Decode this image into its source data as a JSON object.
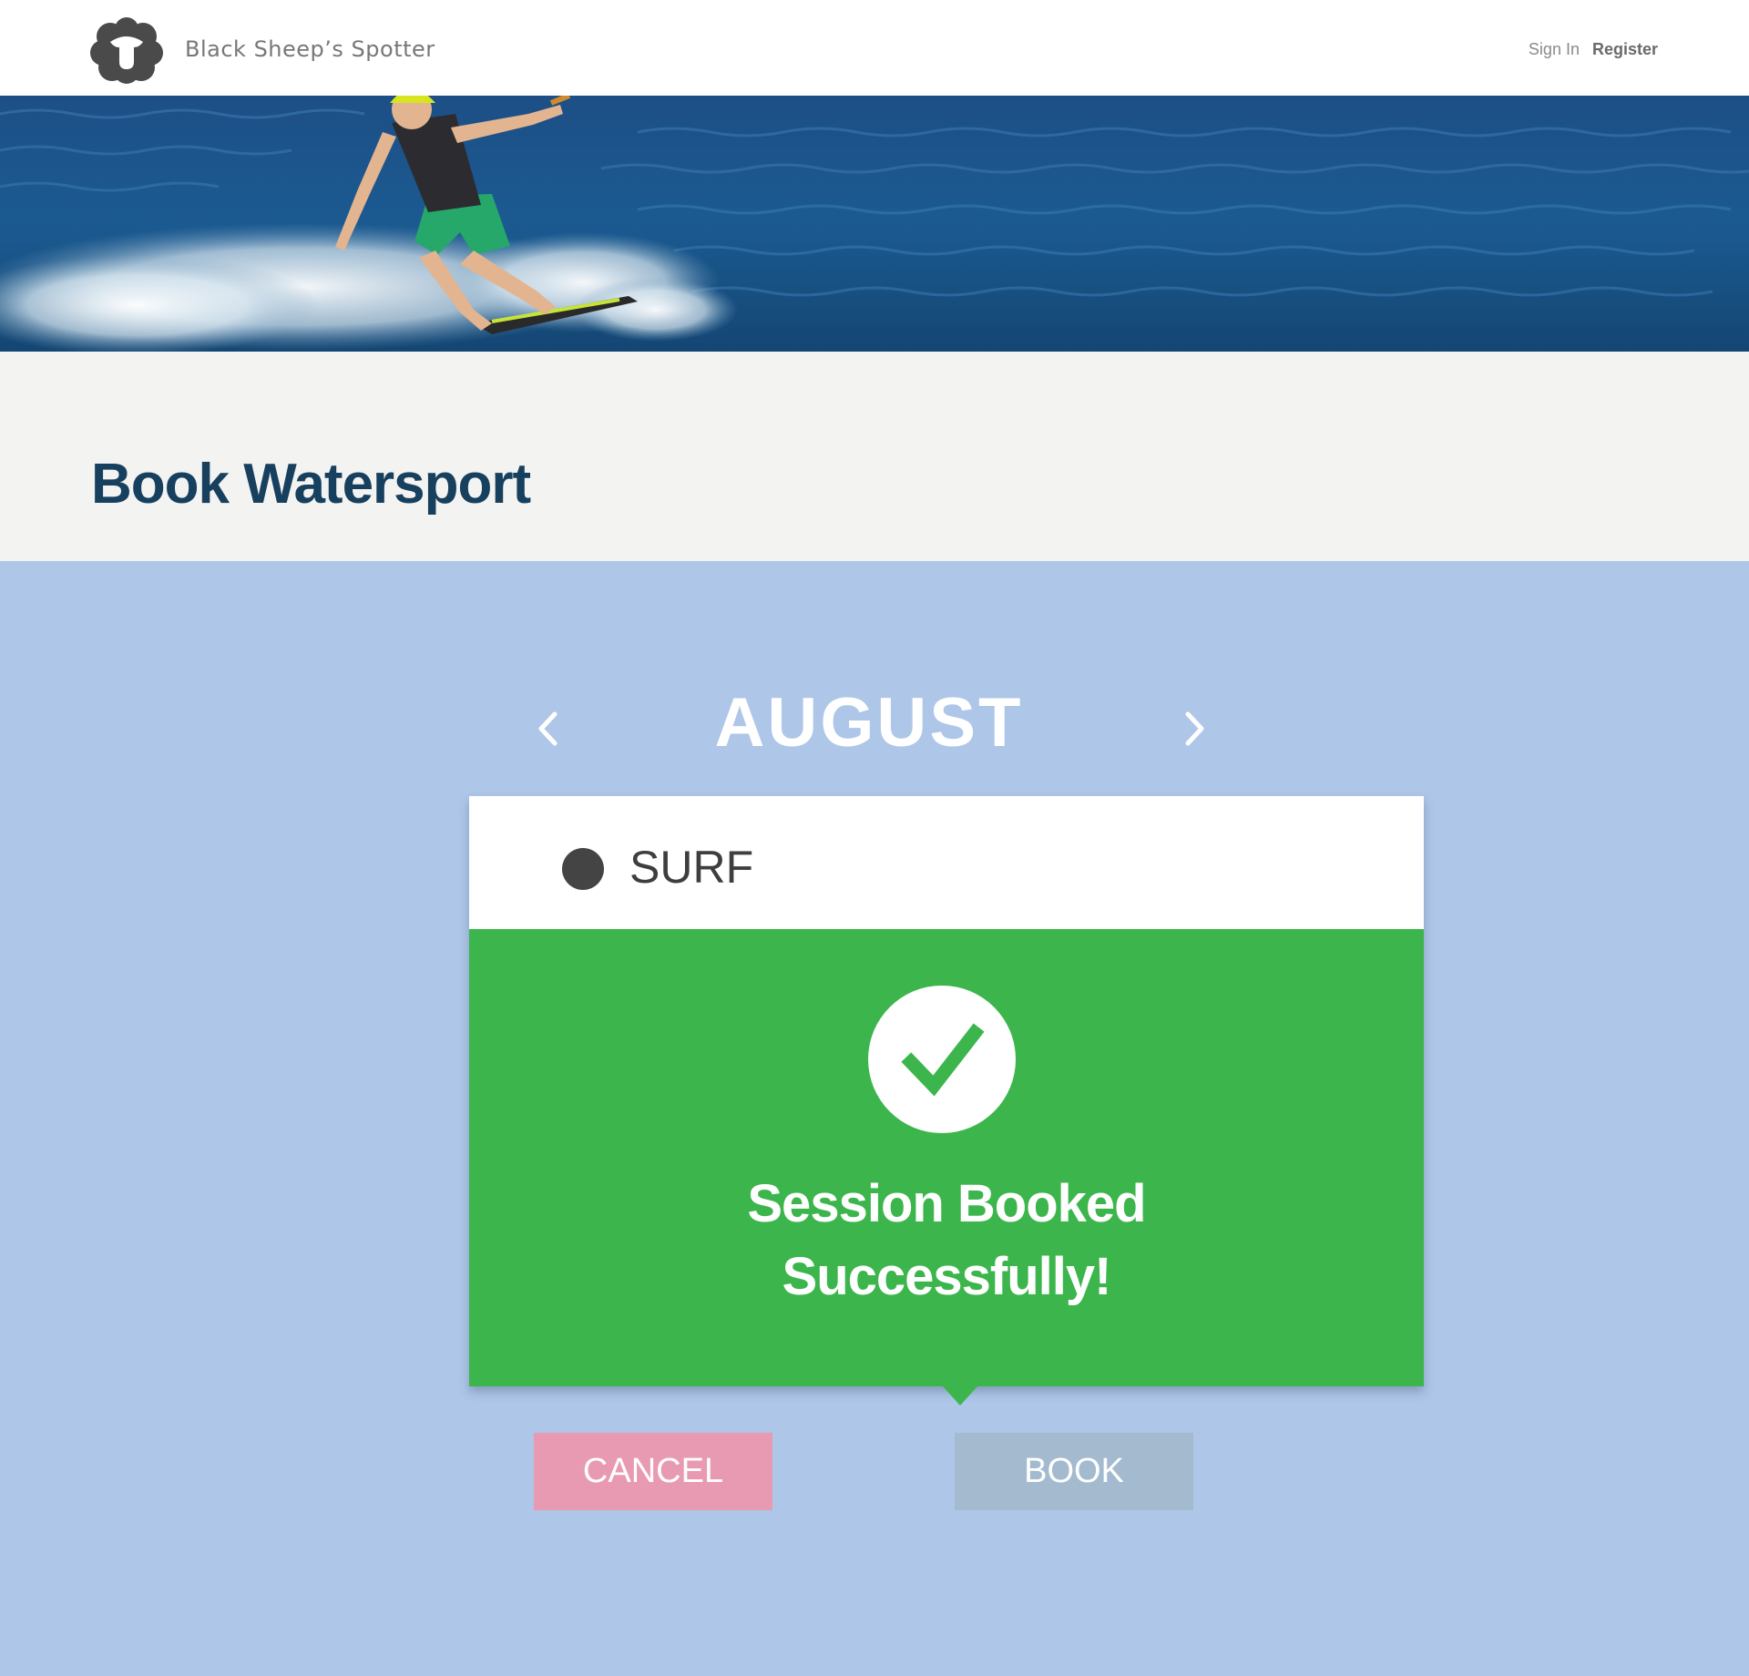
{
  "header": {
    "brand_name": "Black Sheep’s Spotter",
    "nav": {
      "sign_in": "Sign In",
      "register": "Register"
    }
  },
  "hero": {
    "image": "person wakeboarding on blue water"
  },
  "page": {
    "title": "Book Watersport"
  },
  "calendar": {
    "month": "AUGUST",
    "prev_icon": "chevron-left-icon",
    "next_icon": "chevron-right-icon"
  },
  "booking": {
    "sport": "SURF",
    "success_icon": "checkmark-icon",
    "success_line1": "Session Booked",
    "success_line2": "Successfully!"
  },
  "actions": {
    "cancel_label": "CANCEL",
    "book_label": "BOOK"
  },
  "colors": {
    "title": "#17405f",
    "background": "#aec6e8",
    "success": "#3cb64c",
    "cancel": "#e99ab3",
    "book": "#a4bace"
  }
}
